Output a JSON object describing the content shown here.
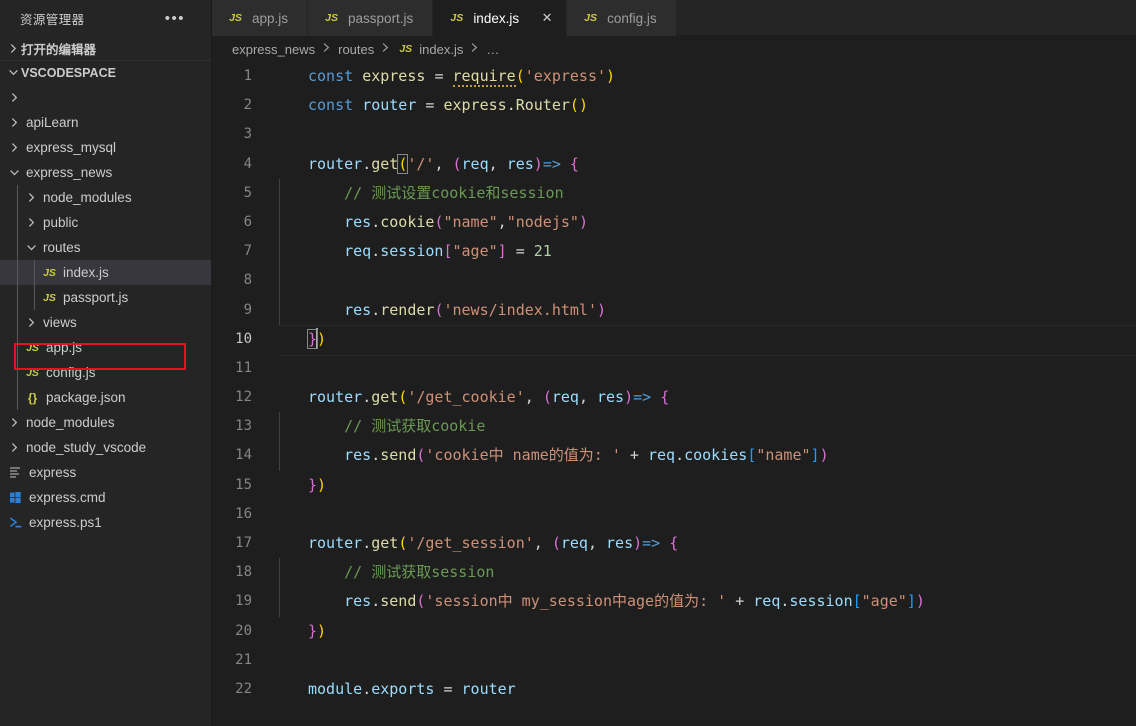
{
  "sidebar": {
    "header_title": "资源管理器",
    "more_icon": "ellipsis-icon",
    "open_editors_label": "打开的编辑器",
    "workspace_label": "VSCODESPACE",
    "tree": [
      {
        "label": "",
        "indent": 1,
        "type": "folder",
        "expanded": false
      },
      {
        "label": "apiLearn",
        "indent": 1,
        "type": "folder",
        "expanded": false
      },
      {
        "label": "express_mysql",
        "indent": 1,
        "type": "folder",
        "expanded": false
      },
      {
        "label": "express_news",
        "indent": 1,
        "type": "folder",
        "expanded": true
      },
      {
        "label": "node_modules",
        "indent": 2,
        "type": "folder",
        "expanded": false
      },
      {
        "label": "public",
        "indent": 2,
        "type": "folder",
        "expanded": false
      },
      {
        "label": "routes",
        "indent": 2,
        "type": "folder",
        "expanded": true
      },
      {
        "label": "index.js",
        "indent": 3,
        "type": "js",
        "selected": true
      },
      {
        "label": "passport.js",
        "indent": 3,
        "type": "js"
      },
      {
        "label": "views",
        "indent": 2,
        "type": "folder",
        "expanded": false
      },
      {
        "label": "app.js",
        "indent": 2,
        "type": "js"
      },
      {
        "label": "config.js",
        "indent": 2,
        "type": "js"
      },
      {
        "label": "package.json",
        "indent": 2,
        "type": "json"
      },
      {
        "label": "node_modules",
        "indent": 1,
        "type": "folder",
        "expanded": false
      },
      {
        "label": "node_study_vscode",
        "indent": 1,
        "type": "folder",
        "expanded": false
      },
      {
        "label": "express",
        "indent": 1,
        "type": "text"
      },
      {
        "label": "express.cmd",
        "indent": 1,
        "type": "cmd"
      },
      {
        "label": "express.ps1",
        "indent": 1,
        "type": "ps1"
      }
    ]
  },
  "tabs": [
    {
      "label": "app.js",
      "icon": "js-file-icon",
      "active": false,
      "closable": false
    },
    {
      "label": "passport.js",
      "icon": "js-file-icon",
      "active": false,
      "closable": false
    },
    {
      "label": "index.js",
      "icon": "js-file-icon",
      "active": true,
      "closable": true,
      "close_label": "✕"
    },
    {
      "label": "config.js",
      "icon": "js-file-icon",
      "active": false,
      "closable": false
    }
  ],
  "breadcrumb": {
    "items": [
      "express_news",
      "routes",
      "index.js",
      "…"
    ],
    "separator": "❯",
    "file_icon": "js-file-icon"
  },
  "editor": {
    "active_line": 10,
    "cursor_line": 10,
    "cursor_column": 3,
    "total_lines_visible": 22,
    "lines": [
      {
        "n": 1,
        "tokens": [
          {
            "t": "const",
            "c": "kw"
          },
          {
            "t": " ",
            "c": "plain"
          },
          {
            "t": "express",
            "c": "fn"
          },
          {
            "t": " ",
            "c": "plain"
          },
          {
            "t": "=",
            "c": "op"
          },
          {
            "t": " ",
            "c": "plain"
          },
          {
            "t": "require",
            "c": "fn squig"
          },
          {
            "t": "(",
            "c": "p0"
          },
          {
            "t": "'express'",
            "c": "str"
          },
          {
            "t": ")",
            "c": "p0"
          }
        ]
      },
      {
        "n": 2,
        "tokens": [
          {
            "t": "const",
            "c": "kw"
          },
          {
            "t": " ",
            "c": "plain"
          },
          {
            "t": "router",
            "c": "var"
          },
          {
            "t": " ",
            "c": "plain"
          },
          {
            "t": "=",
            "c": "op"
          },
          {
            "t": " ",
            "c": "plain"
          },
          {
            "t": "express",
            "c": "fn"
          },
          {
            "t": ".",
            "c": "plain"
          },
          {
            "t": "Router",
            "c": "fn"
          },
          {
            "t": "(",
            "c": "p0"
          },
          {
            "t": ")",
            "c": "p0"
          }
        ]
      },
      {
        "n": 3,
        "tokens": []
      },
      {
        "n": 4,
        "tokens": [
          {
            "t": "router",
            "c": "var"
          },
          {
            "t": ".",
            "c": "plain"
          },
          {
            "t": "get",
            "c": "fn"
          },
          {
            "t": "(",
            "c": "p0 brmatch"
          },
          {
            "t": "'/'",
            "c": "str"
          },
          {
            "t": ",",
            "c": "plain"
          },
          {
            "t": " ",
            "c": "plain"
          },
          {
            "t": "(",
            "c": "p1"
          },
          {
            "t": "req",
            "c": "var"
          },
          {
            "t": ",",
            "c": "plain"
          },
          {
            "t": " ",
            "c": "plain"
          },
          {
            "t": "res",
            "c": "var"
          },
          {
            "t": ")",
            "c": "p1"
          },
          {
            "t": "=>",
            "c": "kw"
          },
          {
            "t": " ",
            "c": "plain"
          },
          {
            "t": "{",
            "c": "p1"
          }
        ]
      },
      {
        "n": 5,
        "indent": 1,
        "tokens": [
          {
            "t": "    // 测试设置cookie和session",
            "c": "cmt"
          }
        ]
      },
      {
        "n": 6,
        "indent": 1,
        "tokens": [
          {
            "t": "    ",
            "c": "plain"
          },
          {
            "t": "res",
            "c": "var"
          },
          {
            "t": ".",
            "c": "plain"
          },
          {
            "t": "cookie",
            "c": "fn"
          },
          {
            "t": "(",
            "c": "p1"
          },
          {
            "t": "\"name\"",
            "c": "str"
          },
          {
            "t": ",",
            "c": "plain"
          },
          {
            "t": "\"nodejs\"",
            "c": "str"
          },
          {
            "t": ")",
            "c": "p1"
          }
        ]
      },
      {
        "n": 7,
        "indent": 1,
        "tokens": [
          {
            "t": "    ",
            "c": "plain"
          },
          {
            "t": "req",
            "c": "var"
          },
          {
            "t": ".",
            "c": "plain"
          },
          {
            "t": "session",
            "c": "var"
          },
          {
            "t": "[",
            "c": "p1"
          },
          {
            "t": "\"age\"",
            "c": "str"
          },
          {
            "t": "]",
            "c": "p1"
          },
          {
            "t": " ",
            "c": "plain"
          },
          {
            "t": "=",
            "c": "op"
          },
          {
            "t": " ",
            "c": "plain"
          },
          {
            "t": "21",
            "c": "num"
          }
        ]
      },
      {
        "n": 8,
        "indent": 1,
        "tokens": []
      },
      {
        "n": 9,
        "indent": 1,
        "tokens": [
          {
            "t": "    ",
            "c": "plain"
          },
          {
            "t": "res",
            "c": "var"
          },
          {
            "t": ".",
            "c": "plain"
          },
          {
            "t": "render",
            "c": "fn"
          },
          {
            "t": "(",
            "c": "p1"
          },
          {
            "t": "'news/index.html'",
            "c": "str"
          },
          {
            "t": ")",
            "c": "p1"
          }
        ]
      },
      {
        "n": 10,
        "active": true,
        "tokens": [
          {
            "t": "}",
            "c": "p1 brmatch"
          },
          {
            "t": "CURSOR",
            "c": "cursor"
          },
          {
            "t": ")",
            "c": "p0"
          }
        ]
      },
      {
        "n": 11,
        "tokens": []
      },
      {
        "n": 12,
        "tokens": [
          {
            "t": "router",
            "c": "var"
          },
          {
            "t": ".",
            "c": "plain"
          },
          {
            "t": "get",
            "c": "fn"
          },
          {
            "t": "(",
            "c": "p0"
          },
          {
            "t": "'/get_cookie'",
            "c": "str"
          },
          {
            "t": ",",
            "c": "plain"
          },
          {
            "t": " ",
            "c": "plain"
          },
          {
            "t": "(",
            "c": "p1"
          },
          {
            "t": "req",
            "c": "var"
          },
          {
            "t": ",",
            "c": "plain"
          },
          {
            "t": " ",
            "c": "plain"
          },
          {
            "t": "res",
            "c": "var"
          },
          {
            "t": ")",
            "c": "p1"
          },
          {
            "t": "=>",
            "c": "kw"
          },
          {
            "t": " ",
            "c": "plain"
          },
          {
            "t": "{",
            "c": "p1"
          }
        ]
      },
      {
        "n": 13,
        "indent": 1,
        "tokens": [
          {
            "t": "    // 测试获取cookie",
            "c": "cmt"
          }
        ]
      },
      {
        "n": 14,
        "indent": 1,
        "tokens": [
          {
            "t": "    ",
            "c": "plain"
          },
          {
            "t": "res",
            "c": "var"
          },
          {
            "t": ".",
            "c": "plain"
          },
          {
            "t": "send",
            "c": "fn"
          },
          {
            "t": "(",
            "c": "p1"
          },
          {
            "t": "'cookie中 name的值为: '",
            "c": "str"
          },
          {
            "t": " ",
            "c": "plain"
          },
          {
            "t": "+",
            "c": "op"
          },
          {
            "t": " ",
            "c": "plain"
          },
          {
            "t": "req",
            "c": "var"
          },
          {
            "t": ".",
            "c": "plain"
          },
          {
            "t": "cookies",
            "c": "var"
          },
          {
            "t": "[",
            "c": "p2"
          },
          {
            "t": "\"name\"",
            "c": "str"
          },
          {
            "t": "]",
            "c": "p2"
          },
          {
            "t": ")",
            "c": "p1"
          }
        ]
      },
      {
        "n": 15,
        "tokens": [
          {
            "t": "}",
            "c": "p1"
          },
          {
            "t": ")",
            "c": "p0"
          }
        ]
      },
      {
        "n": 16,
        "tokens": []
      },
      {
        "n": 17,
        "tokens": [
          {
            "t": "router",
            "c": "var"
          },
          {
            "t": ".",
            "c": "plain"
          },
          {
            "t": "get",
            "c": "fn"
          },
          {
            "t": "(",
            "c": "p0"
          },
          {
            "t": "'/get_session'",
            "c": "str"
          },
          {
            "t": ",",
            "c": "plain"
          },
          {
            "t": " ",
            "c": "plain"
          },
          {
            "t": "(",
            "c": "p1"
          },
          {
            "t": "req",
            "c": "var"
          },
          {
            "t": ",",
            "c": "plain"
          },
          {
            "t": " ",
            "c": "plain"
          },
          {
            "t": "res",
            "c": "var"
          },
          {
            "t": ")",
            "c": "p1"
          },
          {
            "t": "=>",
            "c": "kw"
          },
          {
            "t": " ",
            "c": "plain"
          },
          {
            "t": "{",
            "c": "p1"
          }
        ]
      },
      {
        "n": 18,
        "indent": 1,
        "tokens": [
          {
            "t": "    // 测试获取session",
            "c": "cmt"
          }
        ]
      },
      {
        "n": 19,
        "indent": 1,
        "tokens": [
          {
            "t": "    ",
            "c": "plain"
          },
          {
            "t": "res",
            "c": "var"
          },
          {
            "t": ".",
            "c": "plain"
          },
          {
            "t": "send",
            "c": "fn"
          },
          {
            "t": "(",
            "c": "p1"
          },
          {
            "t": "'session中 my_session中age的值为: '",
            "c": "str"
          },
          {
            "t": " ",
            "c": "plain"
          },
          {
            "t": "+",
            "c": "op"
          },
          {
            "t": " ",
            "c": "plain"
          },
          {
            "t": "req",
            "c": "var"
          },
          {
            "t": ".",
            "c": "plain"
          },
          {
            "t": "session",
            "c": "var"
          },
          {
            "t": "[",
            "c": "p2"
          },
          {
            "t": "\"age\"",
            "c": "str"
          },
          {
            "t": "]",
            "c": "p2"
          },
          {
            "t": ")",
            "c": "p1"
          }
        ]
      },
      {
        "n": 20,
        "tokens": [
          {
            "t": "}",
            "c": "p1"
          },
          {
            "t": ")",
            "c": "p0"
          }
        ]
      },
      {
        "n": 21,
        "tokens": []
      },
      {
        "n": 22,
        "tokens": [
          {
            "t": "module",
            "c": "var"
          },
          {
            "t": ".",
            "c": "plain"
          },
          {
            "t": "exports",
            "c": "var"
          },
          {
            "t": " ",
            "c": "plain"
          },
          {
            "t": "=",
            "c": "op"
          },
          {
            "t": " ",
            "c": "plain"
          },
          {
            "t": "router",
            "c": "var"
          }
        ]
      }
    ]
  },
  "annotation": {
    "color": "#e81123",
    "target": "index.js"
  },
  "colors": {
    "background": "#1e1e1e",
    "sidebar_bg": "#252526",
    "tab_inactive_bg": "#2d2d2d",
    "selection_bg": "#37373d",
    "keyword": "#569cd6",
    "function": "#dcdcaa",
    "variable": "#9cdcfe",
    "string": "#ce9178",
    "comment": "#6a9955",
    "number": "#b5cea8",
    "js_icon": "#cbcb41",
    "annotation_red": "#e81123"
  }
}
